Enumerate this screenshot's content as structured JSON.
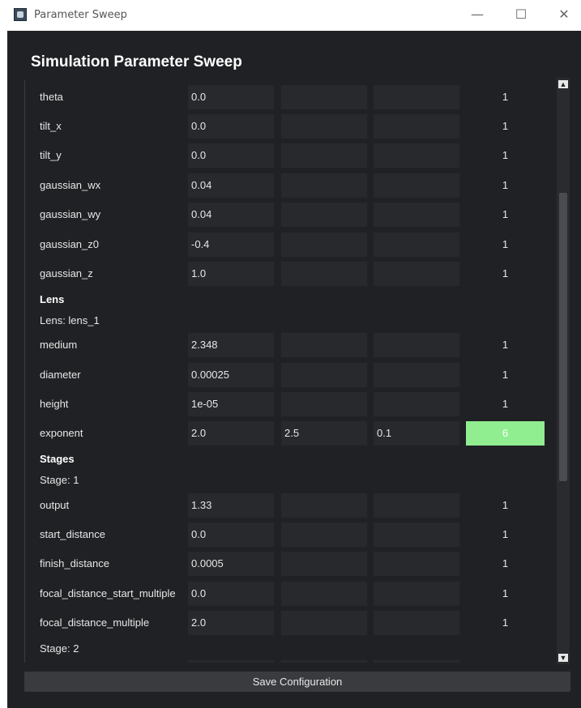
{
  "window": {
    "title": "Parameter Sweep",
    "minimize_glyph": "—",
    "maximize_glyph": "☐",
    "close_glyph": "✕"
  },
  "heading": "Simulation Parameter Sweep",
  "rows_top": [
    {
      "name": "theta",
      "start": "0.0",
      "stop": "",
      "step": "",
      "count": "1"
    },
    {
      "name": "tilt_x",
      "start": "0.0",
      "stop": "",
      "step": "",
      "count": "1"
    },
    {
      "name": "tilt_y",
      "start": "0.0",
      "stop": "",
      "step": "",
      "count": "1"
    },
    {
      "name": "gaussian_wx",
      "start": "0.04",
      "stop": "",
      "step": "",
      "count": "1"
    },
    {
      "name": "gaussian_wy",
      "start": "0.04",
      "stop": "",
      "step": "",
      "count": "1"
    },
    {
      "name": "gaussian_z0",
      "start": "-0.4",
      "stop": "",
      "step": "",
      "count": "1"
    },
    {
      "name": "gaussian_z",
      "start": "1.0",
      "stop": "",
      "step": "",
      "count": "1"
    }
  ],
  "lens": {
    "section_title": "Lens",
    "sublabel": "Lens: lens_1",
    "rows": [
      {
        "name": "medium",
        "start": "2.348",
        "stop": "",
        "step": "",
        "count": "1"
      },
      {
        "name": "diameter",
        "start": "0.00025",
        "stop": "",
        "step": "",
        "count": "1"
      },
      {
        "name": "height",
        "start": "1e-05",
        "stop": "",
        "step": "",
        "count": "1"
      },
      {
        "name": "exponent",
        "start": "2.0",
        "stop": "2.5",
        "step": "0.1",
        "count": "6"
      }
    ]
  },
  "stages": {
    "section_title": "Stages",
    "stage1_label": "Stage: 1",
    "rows": [
      {
        "name": "output",
        "start": "1.33",
        "stop": "",
        "step": "",
        "count": "1"
      },
      {
        "name": "start_distance",
        "start": "0.0",
        "stop": "",
        "step": "",
        "count": "1"
      },
      {
        "name": "finish_distance",
        "start": "0.0005",
        "stop": "",
        "step": "",
        "count": "1"
      },
      {
        "name": "focal_distance_start_multiple",
        "start": "0.0",
        "stop": "",
        "step": "",
        "count": "1"
      },
      {
        "name": "focal_distance_multiple",
        "start": "2.0",
        "stop": "",
        "step": "",
        "count": "1"
      }
    ],
    "stage2_label": "Stage: 2"
  },
  "scrollbar": {
    "up_glyph": "▲",
    "down_glyph": "▼"
  },
  "save_button": "Save Configuration",
  "colors": {
    "highlight": "#90ee90",
    "background": "#202124",
    "field": "#28292d"
  }
}
